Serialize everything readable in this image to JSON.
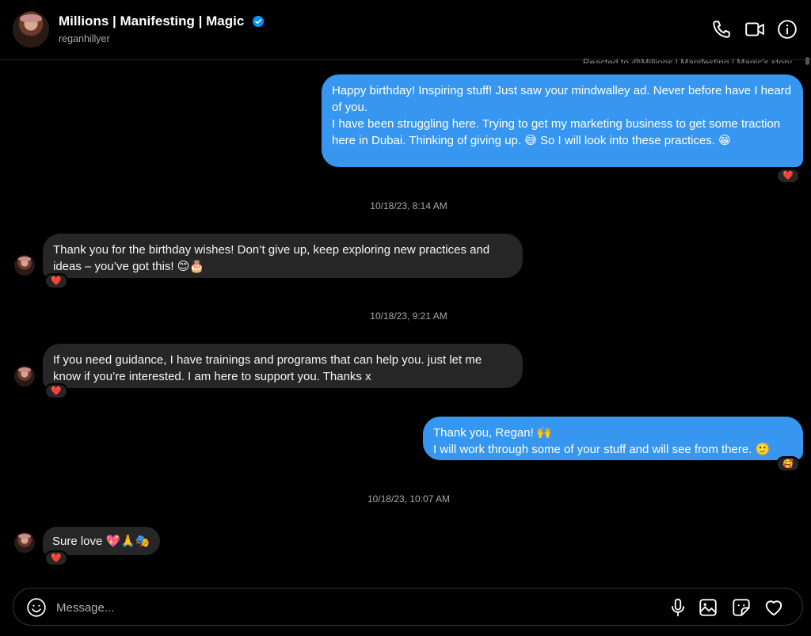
{
  "header": {
    "title": "Millions | Manifesting | Magic",
    "handle": "reganhillyer",
    "icons": [
      "phone-icon",
      "video-camera-icon",
      "info-icon"
    ]
  },
  "reacted_note": "Reacted to @Millions | Manifesting | Magic's story",
  "messages": [
    {
      "direction": "outgoing",
      "text": "Happy birthday! Inspiring stuff! Just saw your mindwalley ad. Never before have I heard of you.\nI have been struggling here. Trying to get my marketing business to get some traction here in Dubai. Thinking of giving up. 😅 So I will look into these practices. 😁",
      "reaction": "❤️"
    },
    {
      "type": "timestamp",
      "text": "10/18/23, 8:14 AM"
    },
    {
      "direction": "incoming",
      "text": "Thank you for the birthday wishes! Don’t give up, keep exploring new practices and ideas – you’ve got this! 😊🎂",
      "reaction": "❤️"
    },
    {
      "type": "timestamp",
      "text": "10/18/23, 9:21 AM"
    },
    {
      "direction": "incoming",
      "text": "If you need guidance, I have trainings and programs that can help you. just let me know if you’re interested. I am here to support you. Thanks x",
      "reaction": "❤️"
    },
    {
      "direction": "outgoing",
      "text": "Thank you, Regan! 🙌\nI will work through some of your stuff and will see from there. 🙂",
      "reaction": "🥰"
    },
    {
      "type": "timestamp",
      "text": "10/18/23, 10:07 AM"
    },
    {
      "direction": "incoming",
      "text": "Sure love 💖🙏🎭",
      "reaction": "❤️"
    }
  ],
  "composer": {
    "placeholder": "Message...",
    "icons": [
      "emoji-icon",
      "microphone-icon",
      "image-icon",
      "sticker-icon",
      "heart-icon"
    ]
  },
  "colors": {
    "background": "#000000",
    "outgoing_bubble": "#3797f0",
    "incoming_bubble": "#262626",
    "verified_badge": "#0095f6"
  }
}
